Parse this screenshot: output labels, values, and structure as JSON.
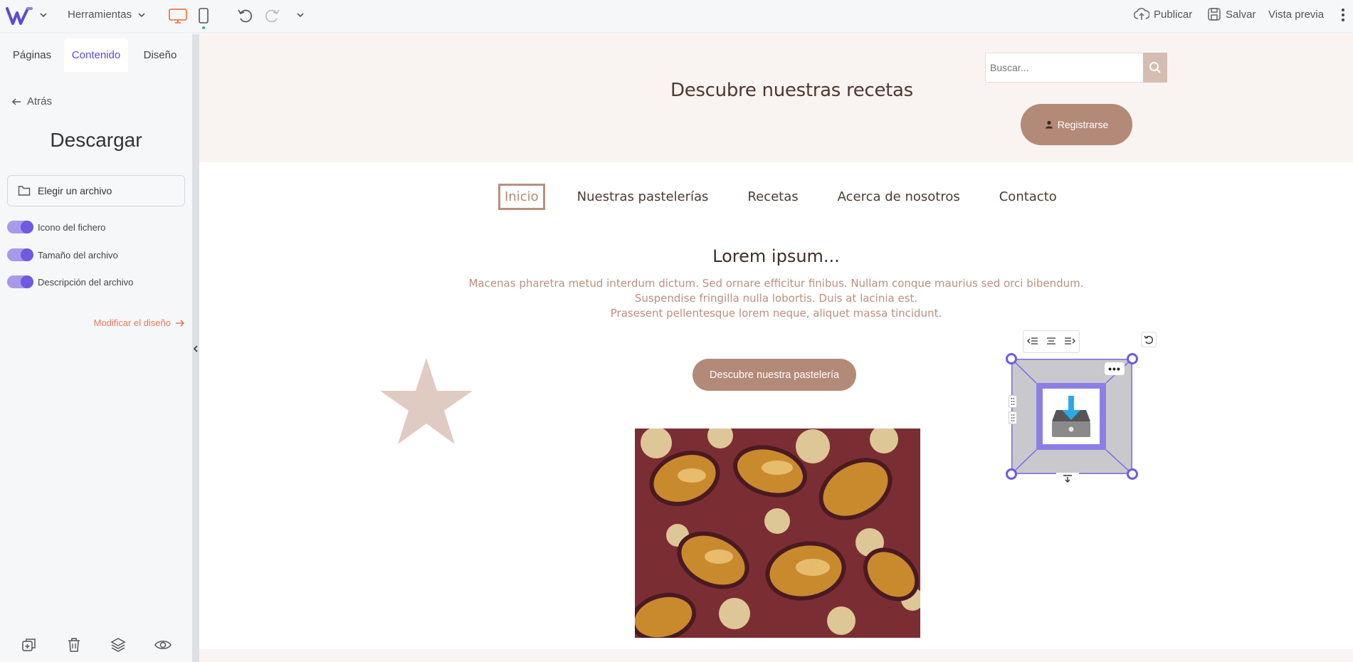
{
  "toolbar": {
    "tools_label": "Herramientas",
    "publish_label": "Publicar",
    "save_label": "Salvar",
    "preview_label": "Vista previa"
  },
  "sidebar": {
    "tabs": [
      {
        "label": "Páginas"
      },
      {
        "label": "Contenido"
      },
      {
        "label": "Diseño"
      }
    ],
    "back_label": "Atrás",
    "title": "Descargar",
    "choose_file_label": "Elegir un archivo",
    "toggles": [
      {
        "label": "Icono del fichero",
        "on": true
      },
      {
        "label": "Tamaño del archivo",
        "on": true
      },
      {
        "label": "Descripción del archivo",
        "on": true
      }
    ],
    "modify_design_label": "Modificar el diseño"
  },
  "site": {
    "hero_title": "Descubre nuestras recetas",
    "search_placeholder": "Buscar...",
    "register_label": "Registrarse",
    "nav": [
      "Inicio",
      "Nuestras pastelerías",
      "Recetas",
      "Acerca de nosotros",
      "Contacto"
    ],
    "section_title": "Lorem ipsum...",
    "section_text": [
      "Macenas pharetra metud interdum dictum. Sed ornare efficitur finibus. Nullam conque maurius sed orci bibendum.",
      "Suspendise fringilla nulla lobortis. Duis at lacinia est.",
      "Prasesent pellentesque lorem neque, aliquet massa tincidunt."
    ],
    "cta_label": "Descubre nuestra pastelería"
  },
  "colors": {
    "accent": "#6f5ae0",
    "brand": "#b38978",
    "orange": "#ea7a55",
    "hero_bg": "#f9f4f1"
  }
}
